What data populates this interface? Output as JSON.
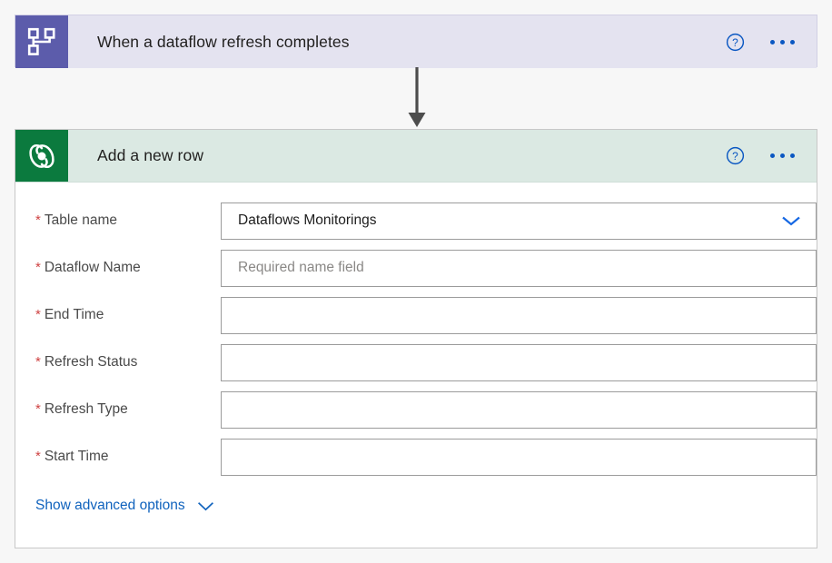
{
  "trigger_card": {
    "title": "When a dataflow refresh completes",
    "icon": "dataflow-hierarchy-icon",
    "icon_bg": "#5c5cab",
    "header_bg": "#e4e3f0",
    "help_icon": "help-circle-icon",
    "more_icon": "more-ellipsis-icon"
  },
  "connector": {
    "icon": "arrow-down-icon",
    "color": "#4d4d4d"
  },
  "action_card": {
    "title": "Add a new row",
    "icon": "dataverse-icon",
    "icon_bg": "#0b7a3e",
    "header_bg": "#dbe9e3",
    "help_icon": "help-circle-icon",
    "more_icon": "more-ellipsis-icon",
    "fields": [
      {
        "label": "Table name",
        "required": true,
        "value": "Dataflows Monitorings",
        "placeholder": "",
        "type": "dropdown",
        "chevron_icon": "chevron-down-icon"
      },
      {
        "label": "Dataflow Name",
        "required": true,
        "value": "",
        "placeholder": "Required name field",
        "type": "text"
      },
      {
        "label": "End Time",
        "required": true,
        "value": "",
        "placeholder": "",
        "type": "text"
      },
      {
        "label": "Refresh Status",
        "required": true,
        "value": "",
        "placeholder": "",
        "type": "text"
      },
      {
        "label": "Refresh Type",
        "required": true,
        "value": "",
        "placeholder": "",
        "type": "text"
      },
      {
        "label": "Start Time",
        "required": true,
        "value": "",
        "placeholder": "",
        "type": "text"
      }
    ],
    "advanced_options": {
      "label": "Show advanced options",
      "chevron_icon": "chevron-down-icon",
      "color": "#0f62bd"
    }
  },
  "colors": {
    "page_bg": "#f7f7f7",
    "required_star": "#cf4343",
    "link_blue": "#0f62bd",
    "action_blue": "#0a57c2"
  }
}
